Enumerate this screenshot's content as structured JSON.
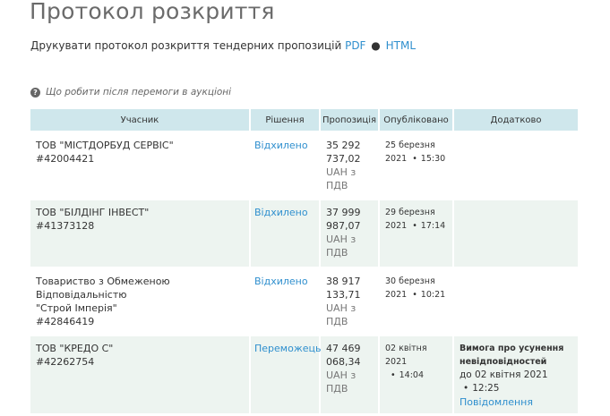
{
  "page_title": "Протокол розкриття",
  "print": {
    "text": "Друкувати протокол розкриття тендерних пропозицій",
    "pdf_label": "PDF",
    "separator": "●",
    "html_label": "HTML"
  },
  "help": {
    "icon_glyph": "?",
    "text": "Що робити після перемоги в аукціоні"
  },
  "table": {
    "headers": [
      "Учасник",
      "Рішення",
      "Пропозиція",
      "Опубліковано",
      "Додатково"
    ],
    "rows": [
      {
        "participant_name": "ТОВ \"МІСТДОРБУД СЕРВІС\"",
        "participant_code": "#42004421",
        "decision": "Відхилено",
        "amount_1": "35 292",
        "amount_2": "737,02",
        "currency_1": "UAH з",
        "currency_2": "ПДВ",
        "date": "25 березня",
        "year": "2021",
        "bullet": "•",
        "time": "15:30"
      },
      {
        "participant_name": "ТОВ \"БІЛДІНГ ІНВЕСТ\"",
        "participant_code": "#41373128",
        "decision": "Відхилено",
        "amount_1": "37 999",
        "amount_2": "987,07",
        "currency_1": "UAH з",
        "currency_2": "ПДВ",
        "date": "29 березня",
        "year": "2021",
        "bullet": "•",
        "time": "17:14"
      },
      {
        "participant_name_1": "Товариство з Обмеженою Відповідальністю",
        "participant_name_2": "\"Строй Імперія\"",
        "participant_code": "#42846419",
        "decision": "Відхилено",
        "amount_1": "38 917",
        "amount_2": "133,71",
        "currency_1": "UAH з",
        "currency_2": "ПДВ",
        "date": "30 березня",
        "year": "2021",
        "bullet": "•",
        "time": "10:21"
      },
      {
        "participant_name": "ТОВ \"КРЕДО С\"",
        "participant_code": "#42262754",
        "decision": "Переможець",
        "amount_1": "47 469",
        "amount_2": "068,34",
        "currency_1": "UAH з",
        "currency_2": "ПДВ",
        "date": "02 квітня 2021",
        "bullet": "•",
        "time": "14:04",
        "extra_title_1": "Вимога про усунення",
        "extra_title_2": "невідповідностей",
        "extra_due": "до 02 квітня 2021",
        "extra_bullet": "•",
        "extra_time": "12:25",
        "extra_link": "Повідомлення"
      }
    ]
  }
}
